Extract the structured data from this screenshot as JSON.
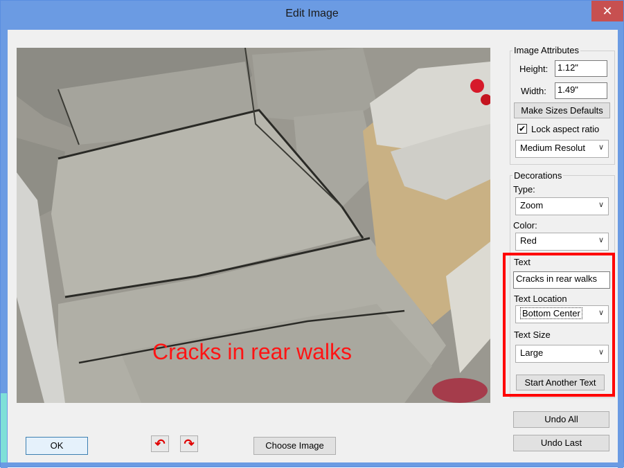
{
  "window": {
    "title": "Edit Image",
    "close_glyph": "✕"
  },
  "image": {
    "overlay_text": "Cracks in rear walks",
    "overlay_color": "#ff1414"
  },
  "attributes": {
    "group_label": "Image Attributes",
    "height_label": "Height:",
    "height_value": "1.12\"",
    "width_label": "Width:",
    "width_value": "1.49\"",
    "make_defaults_label": "Make Sizes Defaults",
    "lock_aspect_label": "Lock aspect ratio",
    "lock_aspect_checked": true,
    "resolution_value": "Medium Resolut"
  },
  "decorations": {
    "group_label": "Decorations",
    "type_label": "Type:",
    "type_value": "Zoom",
    "color_label": "Color:",
    "color_value": "Red",
    "text_label": "Text",
    "text_value": "Cracks in rear walks",
    "text_location_label": "Text Location",
    "text_location_value": "Bottom Center",
    "text_size_label": "Text Size",
    "text_size_value": "Large",
    "start_another_label": "Start Another Text"
  },
  "actions": {
    "undo_all_label": "Undo All",
    "undo_last_label": "Undo Last",
    "ok_label": "OK",
    "choose_image_label": "Choose Image",
    "rotate_left_icon": "rotate-left-icon",
    "rotate_right_icon": "rotate-right-icon"
  },
  "colors": {
    "titlebar": "#6b9be3",
    "close": "#c75050",
    "highlight": "#ff0000"
  }
}
